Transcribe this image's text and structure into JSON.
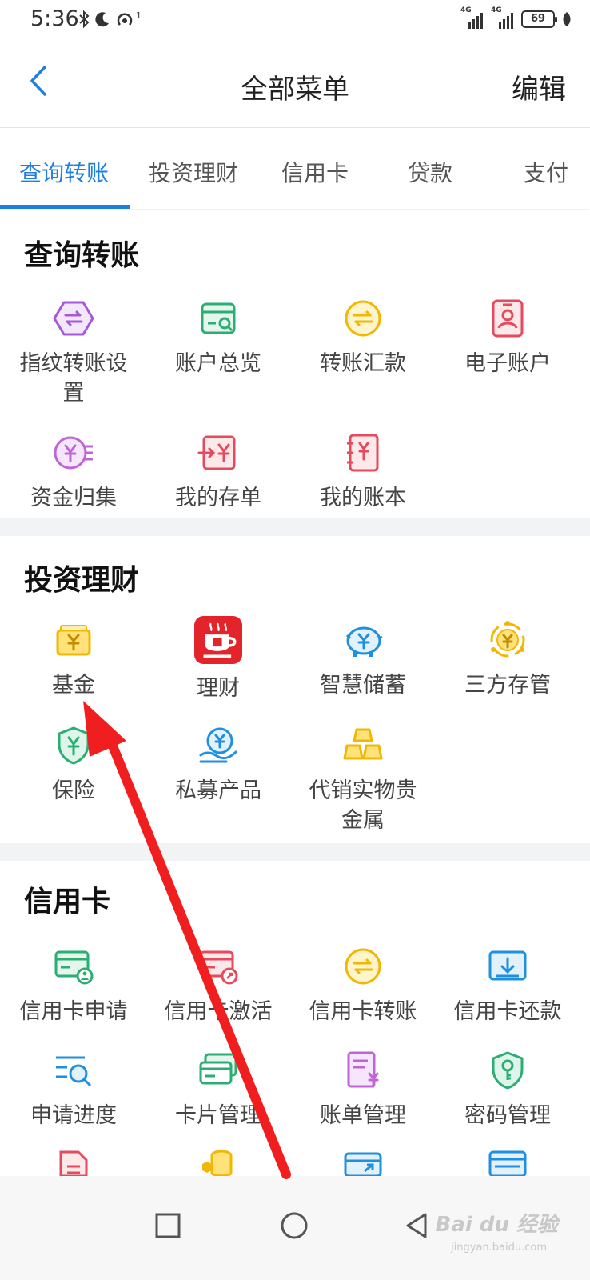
{
  "status_bar": {
    "time": "5:36",
    "battery": "69",
    "network_1": "4G",
    "network_2": "4G",
    "hotspot_sup": "1"
  },
  "header": {
    "title": "全部菜单",
    "edit_label": "编辑"
  },
  "tabs": [
    {
      "label": "查询转账",
      "active": true
    },
    {
      "label": "投资理财",
      "active": false
    },
    {
      "label": "信用卡",
      "active": false
    },
    {
      "label": "贷款",
      "active": false
    },
    {
      "label": "支付",
      "active": false
    }
  ],
  "sections": {
    "transfer": {
      "title": "查询转账",
      "items": [
        {
          "label": "指纹转账设置",
          "icon": "fingerprint-transfer-icon"
        },
        {
          "label": "账户总览",
          "icon": "account-overview-icon"
        },
        {
          "label": "转账汇款",
          "icon": "transfer-icon"
        },
        {
          "label": "电子账户",
          "icon": "e-account-icon"
        },
        {
          "label": "资金归集",
          "icon": "fund-collection-icon"
        },
        {
          "label": "我的存单",
          "icon": "deposit-certificate-icon"
        },
        {
          "label": "我的账本",
          "icon": "ledger-icon"
        }
      ]
    },
    "invest": {
      "title": "投资理财",
      "items": [
        {
          "label": "基金",
          "icon": "fund-icon"
        },
        {
          "label": "理财",
          "icon": "wealth-cup-icon"
        },
        {
          "label": "智慧储蓄",
          "icon": "piggy-bank-icon"
        },
        {
          "label": "三方存管",
          "icon": "third-party-custody-icon"
        },
        {
          "label": "保险",
          "icon": "insurance-shield-icon"
        },
        {
          "label": "私募产品",
          "icon": "private-equity-icon"
        },
        {
          "label": "代销实物贵金属",
          "icon": "gold-bars-icon"
        }
      ]
    },
    "credit": {
      "title": "信用卡",
      "items": [
        {
          "label": "信用卡申请",
          "icon": "card-apply-icon"
        },
        {
          "label": "信用卡激活",
          "icon": "card-activate-icon"
        },
        {
          "label": "信用卡转账",
          "icon": "card-transfer-icon"
        },
        {
          "label": "信用卡还款",
          "icon": "card-repay-icon"
        },
        {
          "label": "申请进度",
          "icon": "application-progress-icon"
        },
        {
          "label": "卡片管理",
          "icon": "card-management-icon"
        },
        {
          "label": "账单管理",
          "icon": "bill-management-icon"
        },
        {
          "label": "密码管理",
          "icon": "password-management-icon"
        }
      ]
    }
  },
  "colors": {
    "accent": "#1f7fe0",
    "arrow": "#f01e1e"
  },
  "watermark": {
    "brand": "Bai du 经验",
    "url": "jingyan.baidu.com"
  }
}
